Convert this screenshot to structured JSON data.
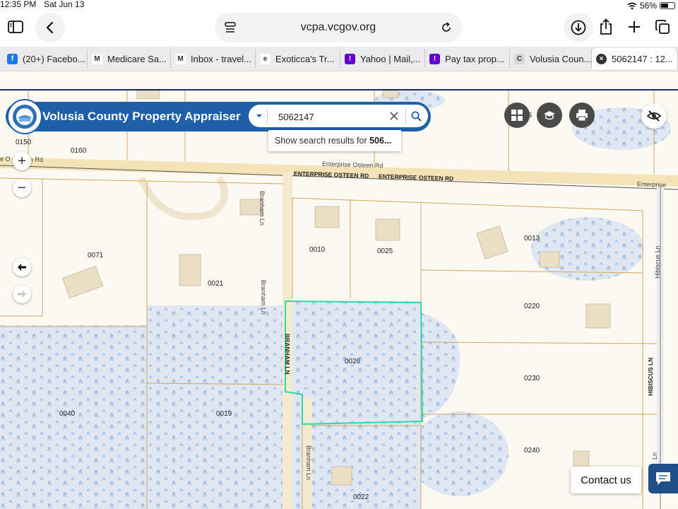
{
  "status_bar": {
    "time": "12:35 PM",
    "date": "Sat Jun 13",
    "battery": "56%",
    "battery_level": 0.56
  },
  "browser": {
    "url": "vcpa.vcgov.org",
    "tabs": [
      {
        "label": "(20+) Facebo...",
        "icon": "facebook-icon",
        "color": "#1877f2",
        "glyph": "f"
      },
      {
        "label": "Medicare Sa...",
        "icon": "medicare-m-icon",
        "color": "#ffffff",
        "glyph": "M"
      },
      {
        "label": "Inbox - travel...",
        "icon": "gmail-icon",
        "color": "#ffffff",
        "glyph": "M"
      },
      {
        "label": "Exoticca's Tr...",
        "icon": "exoticca-icon",
        "color": "#ffffff",
        "glyph": "e"
      },
      {
        "label": "Yahoo | Mail,...",
        "icon": "yahoo-icon",
        "color": "#6001d2",
        "glyph": "!"
      },
      {
        "label": "Pay tax prop...",
        "icon": "yahoo-icon",
        "color": "#6001d2",
        "glyph": "!"
      },
      {
        "label": "Volusia Coun...",
        "icon": "generic-site-icon",
        "color": "#d6d6d6",
        "glyph": "C"
      },
      {
        "label": "5062147 : 12...",
        "icon": "close-icon",
        "color": "#ffffff",
        "glyph": "×",
        "active": true
      }
    ]
  },
  "app": {
    "title": "Volusia County Property Appraiser",
    "search_value": "5062147",
    "suggestion_prefix": "Show search results for ",
    "suggestion_term": "506...",
    "brand_color": "#1f5ea8"
  },
  "map": {
    "parcel_labels": [
      "0150",
      "0160",
      "0071",
      "0021",
      "0010",
      "0025",
      "0013",
      "0220",
      "0026",
      "0230",
      "0040",
      "0019",
      "0240",
      "0022",
      "15"
    ],
    "road_labels": {
      "enterprise_osteen_rd": "Enterprise Osteen Rd",
      "enterprise_osteen_rd_caps": "ENTERPRISE OSTEEN RD",
      "enterprise_osteen_rd_caps_2": "ENTERPRISE OSTEEN RD",
      "enterprise_right": "Enterprise",
      "left_rd_fragment": "e O",
      "left_rd_fragment_2": "n Rd",
      "branham_ln_1": "Branham Ln",
      "branham_ln_2": "Branham Ln",
      "branham_ln_3": "Branham Ln",
      "branham_ln_caps": "BRANHAM LN",
      "hibiscus_ln": "Hibiscus Ln",
      "hibiscus_ln_caps": "HIBISCUS LN",
      "hibiscus_ln_lower": "Ln"
    },
    "selected_parcel": "0026",
    "highlight_color": "#2ed8a8"
  },
  "controls": {
    "zoom_in": "+",
    "zoom_out": "−",
    "contact": "Contact us"
  }
}
